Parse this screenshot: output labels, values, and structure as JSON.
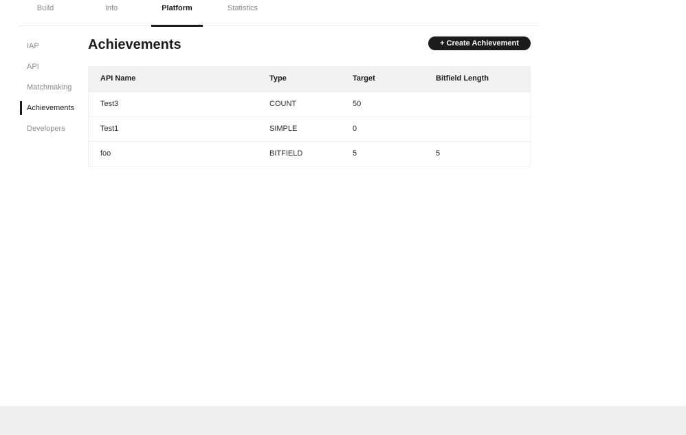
{
  "top_tabs": [
    {
      "label": "Build"
    },
    {
      "label": "Info"
    },
    {
      "label": "Platform"
    },
    {
      "label": "Statistics"
    }
  ],
  "active_top_tab": "Platform",
  "side_nav": [
    {
      "label": "IAP"
    },
    {
      "label": "API"
    },
    {
      "label": "Matchmaking"
    },
    {
      "label": "Achievements"
    },
    {
      "label": "Developers"
    }
  ],
  "active_side_item": "Achievements",
  "main": {
    "title": "Achievements",
    "create_button_label": "+ Create Achievement"
  },
  "table": {
    "headers": [
      "API Name",
      "Type",
      "Target",
      "Bitfield Length"
    ],
    "rows": [
      [
        "Test3",
        "COUNT",
        "50",
        ""
      ],
      [
        "Test1",
        "SIMPLE",
        "0",
        ""
      ],
      [
        "foo",
        "BITFIELD",
        "5",
        "5"
      ]
    ]
  },
  "colors": {
    "accent": "#1c1c1c",
    "muted_text": "#8a8a8a",
    "table_header_bg": "#f1f1f1",
    "footer_bg": "#efefef"
  }
}
